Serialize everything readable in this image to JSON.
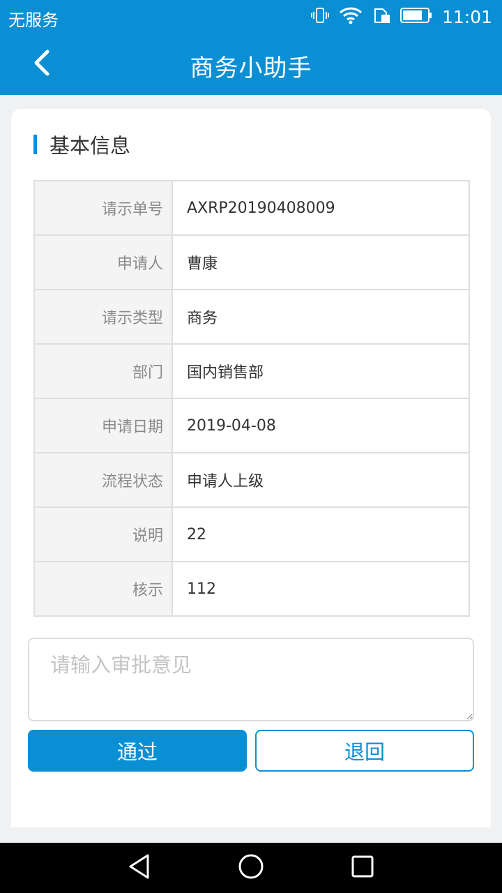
{
  "status_bar": {
    "carrier": "无服务",
    "time": "11:01",
    "icons": [
      "vibrate-icon",
      "wifi-icon",
      "sim-card-icon",
      "battery-icon"
    ]
  },
  "header": {
    "title": "商务小助手",
    "back_icon": "chevron-left-icon"
  },
  "section": {
    "title": "基本信息"
  },
  "details": [
    {
      "label": "请示单号",
      "value": "AXRP20190408009"
    },
    {
      "label": "申请人",
      "value": "曹康"
    },
    {
      "label": "请示类型",
      "value": "商务"
    },
    {
      "label": "部门",
      "value": "国内销售部"
    },
    {
      "label": "申请日期",
      "value": "2019-04-08"
    },
    {
      "label": "流程状态",
      "value": "申请人上级"
    },
    {
      "label": "说明",
      "value": "22"
    },
    {
      "label": "核示",
      "value": "112"
    }
  ],
  "opinion": {
    "placeholder": "请输入审批意见",
    "value": ""
  },
  "actions": {
    "approve_label": "通过",
    "return_label": "退回"
  },
  "nav_bar": {
    "icons": [
      "back-triangle-icon",
      "home-circle-icon",
      "recents-square-icon"
    ]
  },
  "colors": {
    "primary": "#0b8fd4",
    "background": "#f0f1f3",
    "label_bg": "#f4f4f4"
  }
}
